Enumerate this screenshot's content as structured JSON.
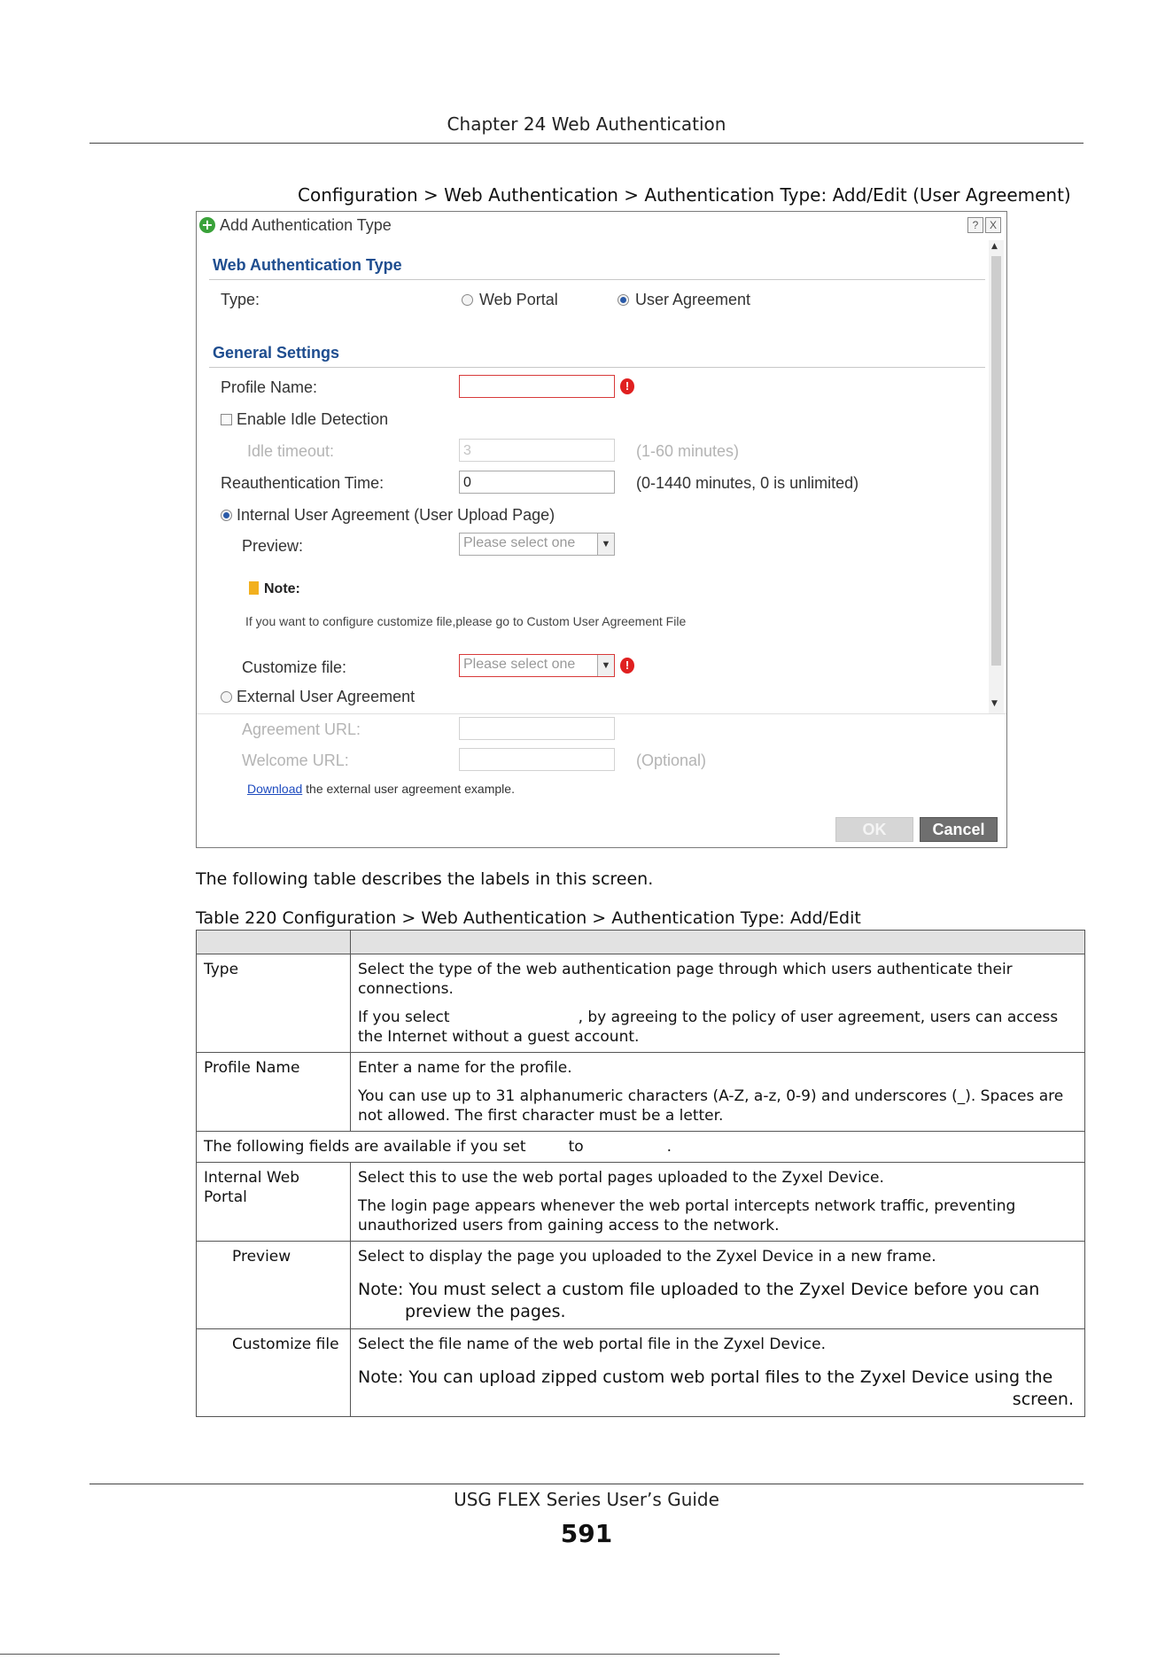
{
  "header": {
    "chapter": "Chapter 24 Web Authentication"
  },
  "figure": {
    "caption": "Configuration > Web Authentication > Authentication Type: Add/Edit (User Agreement)"
  },
  "dialog": {
    "title": "Add Authentication Type",
    "help_icon": "?",
    "close_icon": "X",
    "section_type": "Web Authentication Type",
    "type_label": "Type:",
    "type_options": [
      "Web Portal",
      "User Agreement"
    ],
    "type_selected": "User Agreement",
    "section_general": "General Settings",
    "profile_name_label": "Profile Name:",
    "profile_name_value": "",
    "enable_idle_label": "Enable Idle Detection",
    "idle_timeout_label": "Idle timeout:",
    "idle_timeout_value": "3",
    "idle_timeout_hint": "(1-60 minutes)",
    "reauth_label": "Reauthentication Time:",
    "reauth_value": "0",
    "reauth_hint": "(0-1440 minutes, 0 is unlimited)",
    "internal_label": "Internal User Agreement (User Upload Page)",
    "preview_label": "Preview:",
    "preview_placeholder": "Please select one",
    "note_label": "Note:",
    "note_text": "If you want to configure customize file,please go to Custom User Agreement File",
    "customize_label": "Customize file:",
    "customize_placeholder": "Please select one",
    "external_label": "External User Agreement",
    "agreement_url_label": "Agreement URL:",
    "welcome_url_label": "Welcome URL:",
    "welcome_url_hint": "(Optional)",
    "download_link": "Download",
    "download_text": "the external user agreement example.",
    "ok_label": "OK",
    "cancel_label": "Cancel"
  },
  "intro_text": "The following table describes the labels in this screen.",
  "table": {
    "caption": "Table 220   Configuration > Web Authentication > Authentication Type: Add/Edit",
    "rows": {
      "type": {
        "label": "Type",
        "p1": "Select the type of the web authentication page through which users authenticate their connections.",
        "p2a": "If you select",
        "p2b": ", by agreeing to the policy of user agreement, users can access the Internet without a guest account."
      },
      "profile": {
        "label": "Profile Name",
        "p1": "Enter a name for the profile.",
        "p2": "You can use up to 31 alphanumeric characters (A-Z, a-z, 0-9) and underscores (_). Spaces are not allowed. The first character must be a letter."
      },
      "span": {
        "a": "The following fields are available if you set",
        "b": "to",
        "c": "."
      },
      "internal": {
        "label": "Internal Web Portal",
        "p1": "Select this to use the web portal pages uploaded to the Zyxel Device.",
        "p2": "The login page appears whenever the web portal intercepts network traffic, preventing unauthorized users from gaining access to the network."
      },
      "preview": {
        "label": "Preview",
        "p1": "Select to display the page you uploaded to the Zyxel Device in a new frame.",
        "note_a": "Note: You must select a custom file uploaded to the Zyxel Device before you can",
        "note_b": "preview the pages."
      },
      "customize": {
        "label": "Customize file",
        "p1": "Select the file name of the web portal file in the Zyxel Device.",
        "note_a": "Note: You can upload zipped custom web portal files to the Zyxel Device using the",
        "note_b": "screen."
      }
    }
  },
  "footer": {
    "title": "USG FLEX Series User’s Guide",
    "page": "591"
  }
}
